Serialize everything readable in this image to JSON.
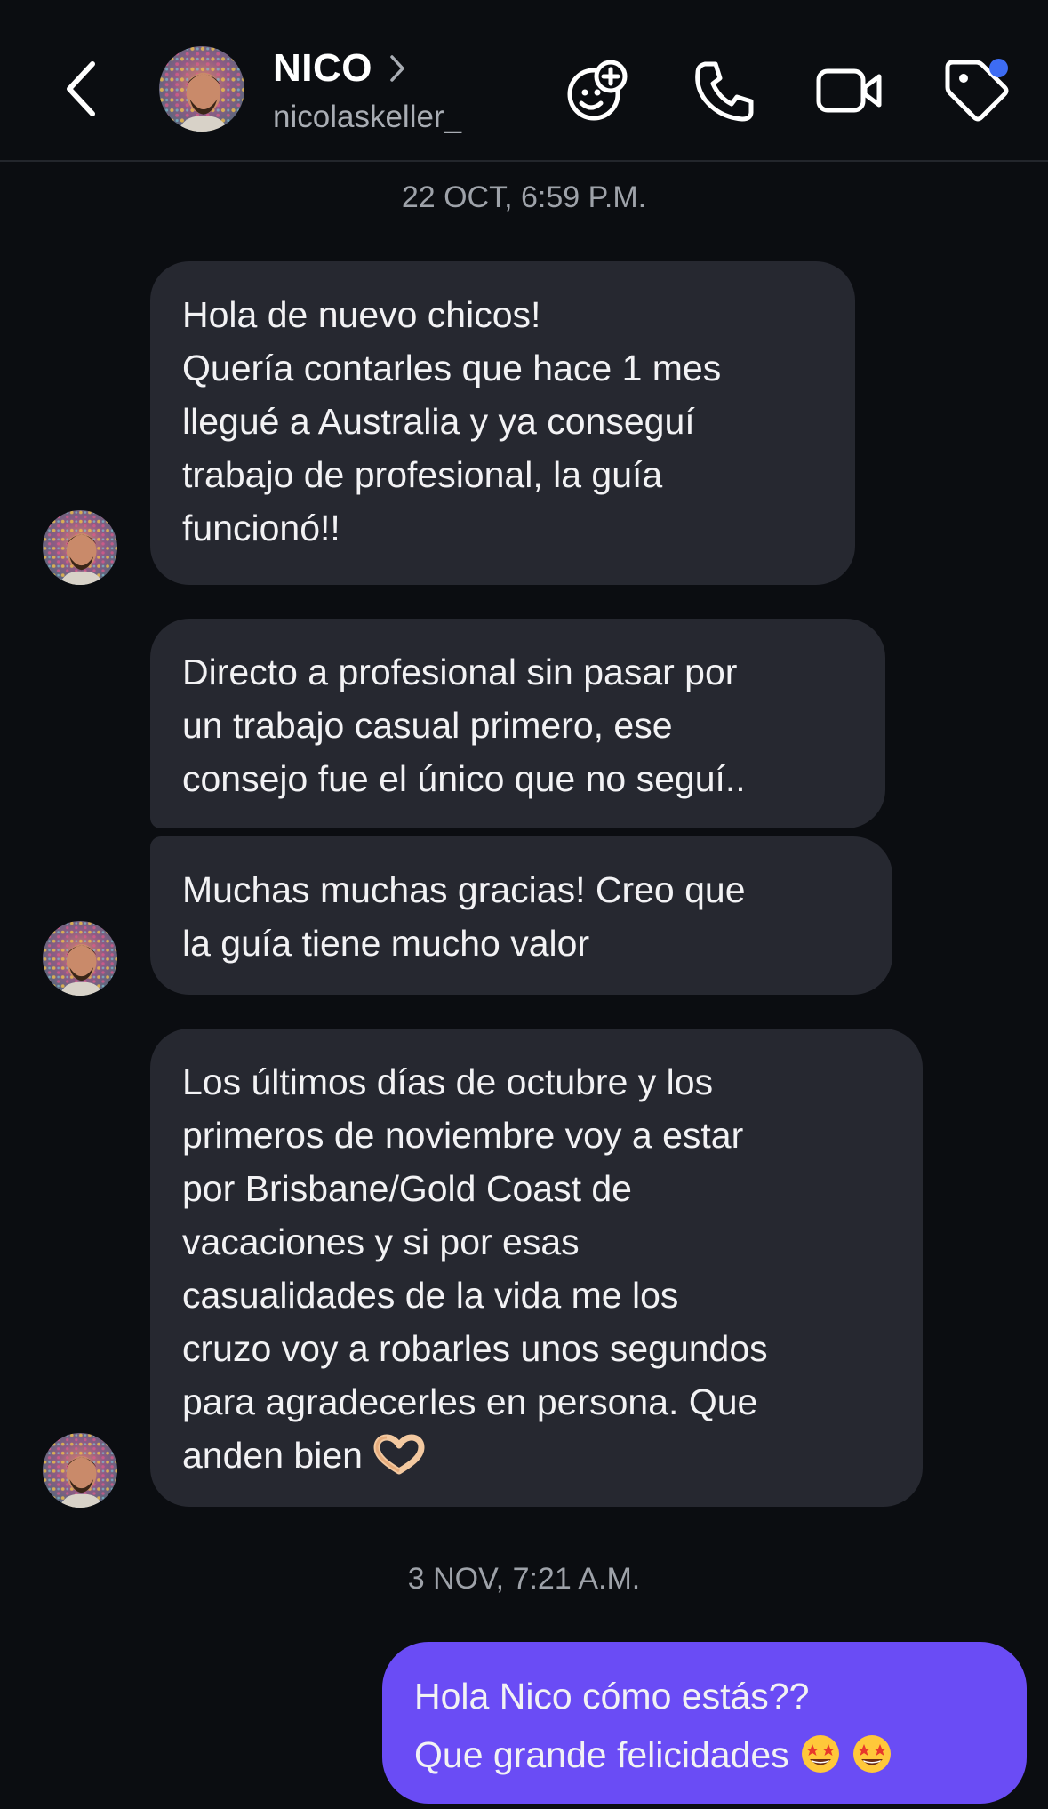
{
  "header": {
    "contact_name": "NICO",
    "username": "nicolaskeller_",
    "icons": {
      "back": "chevron-left-icon",
      "chevron": "chevron-right-icon",
      "effects": "effects-face-icon",
      "call": "phone-icon",
      "video": "video-camera-icon",
      "label": "tag-icon"
    },
    "notification_color": "#3d6cf4"
  },
  "conversation": {
    "timestamp_1": "22 OCT, 6:59 P.M.",
    "timestamp_2": "3 NOV, 7:21 A.M.",
    "incoming_bubble_color": "#262830",
    "outgoing_bubble_color": "#6a4cf5",
    "messages": [
      {
        "direction": "incoming",
        "lines": [
          "Hola de nuevo chicos!",
          "Quería contarles que hace 1 mes",
          "llegué a Australia y ya conseguí",
          "trabajo de profesional, la guía",
          "funcionó!!"
        ]
      },
      {
        "direction": "incoming",
        "lines": [
          "Directo a profesional sin pasar por",
          "un trabajo casual primero, ese",
          "consejo fue el único que no seguí.."
        ]
      },
      {
        "direction": "incoming",
        "lines": [
          "Muchas muchas gracias! Creo que",
          "la guía tiene mucho valor"
        ]
      },
      {
        "direction": "incoming",
        "lines": [
          "Los últimos días de octubre y los",
          "primeros de noviembre voy a estar",
          "por Brisbane/Gold Coast de",
          "vacaciones y si por esas",
          "casualidades de la vida me los",
          "cruzo voy a robarles unos segundos",
          "para agradecerles en persona. Que",
          "anden bien"
        ],
        "emoji": "heart-hands-emoji"
      },
      {
        "direction": "outgoing",
        "lines": [
          "Hola Nico cómo estás??",
          "Que grande felicidades"
        ],
        "emoji": "star-struck-emoji"
      }
    ]
  }
}
